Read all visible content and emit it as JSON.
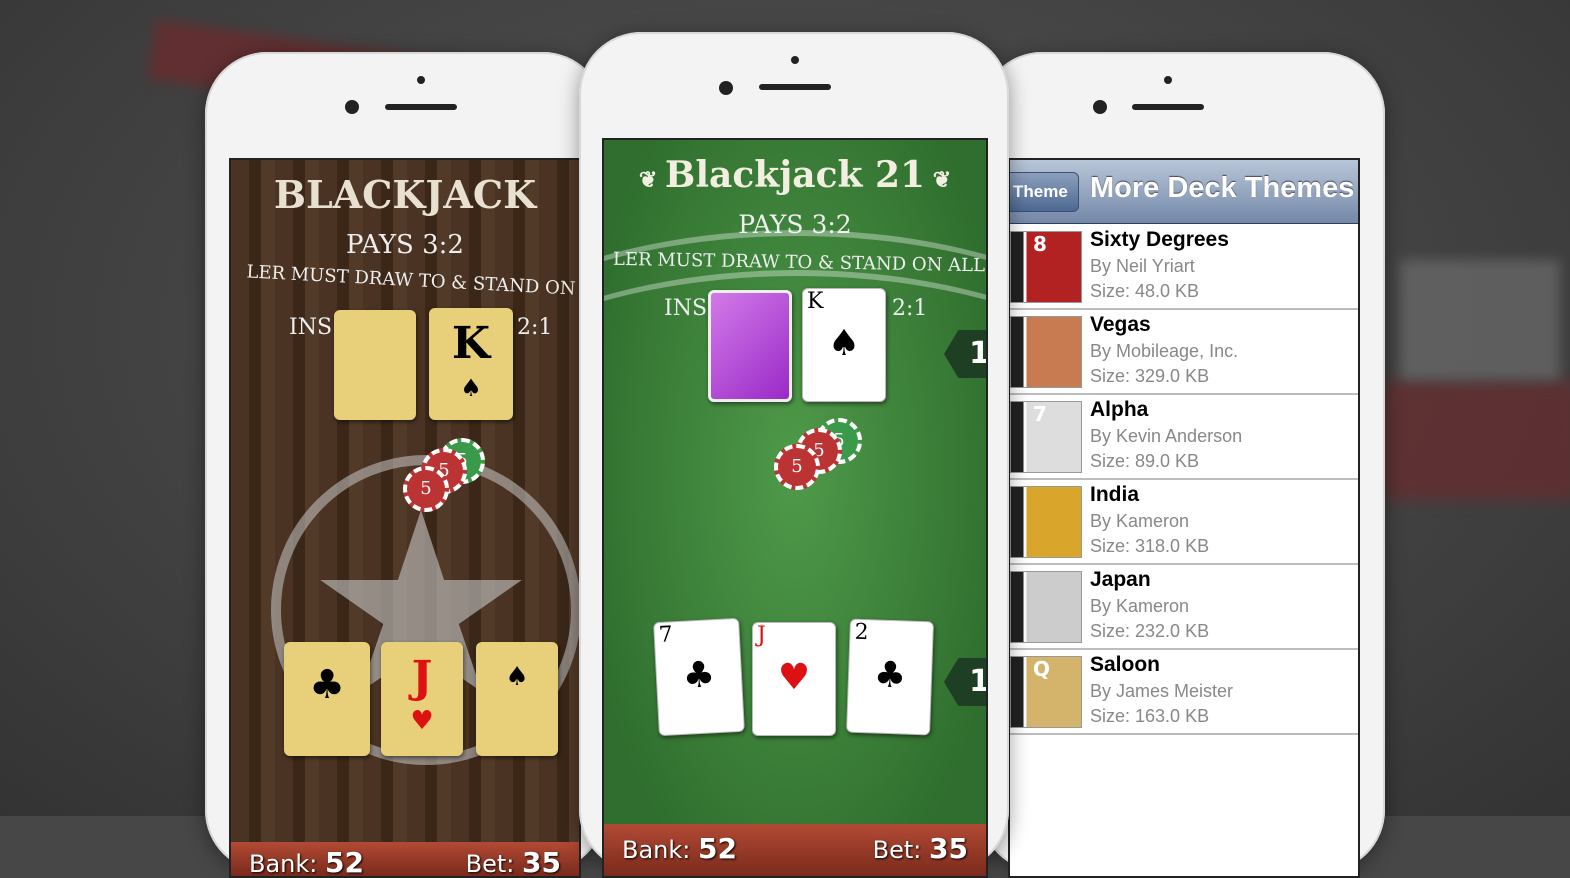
{
  "left_game": {
    "title": "BLACKJACK",
    "pays": "PAYS 3:2",
    "rule": "LER MUST DRAW TO & STAND ON",
    "insurance_left": "INS",
    "insurance_right": "2:1",
    "dealer_cards": [
      {
        "rank": "",
        "suit": ""
      },
      {
        "rank": "K",
        "suit": "♠"
      }
    ],
    "chips": [
      "5",
      "5",
      "5"
    ],
    "player_cards": [
      {
        "rank": "",
        "suit": "♣"
      },
      {
        "rank": "J",
        "suit": "♥"
      },
      {
        "rank": "",
        "suit": "♠"
      }
    ],
    "bank_label": "Bank:",
    "bank": "52",
    "bet_label": "Bet:",
    "bet": "35"
  },
  "center_game": {
    "title": "Blackjack 21",
    "pays": "PAYS 3:2",
    "rule": "LER MUST DRAW TO & STAND ON ALL",
    "insurance_left": "INS",
    "insurance_right": "2:1",
    "dealer_cards": [
      {
        "rank": "",
        "suit": "",
        "face_down": true
      },
      {
        "rank": "K",
        "suit": "♠"
      }
    ],
    "chips": [
      "5",
      "5",
      "5"
    ],
    "player_cards": [
      {
        "rank": "7",
        "suit": "♣"
      },
      {
        "rank": "J",
        "suit": "♥"
      },
      {
        "rank": "2",
        "suit": "♣"
      }
    ],
    "hand_markers": [
      "1",
      "1"
    ],
    "bank_label": "Bank:",
    "bank": "52",
    "bet_label": "Bet:",
    "bet": "35"
  },
  "themes_screen": {
    "back_button": "Theme",
    "title": "More Deck Themes",
    "items": [
      {
        "name": "Sixty Degrees",
        "author": "By Neil Yriart",
        "size": "Size: 48.0 KB",
        "thumb": "#b22222",
        "thumb_text": "8"
      },
      {
        "name": "Vegas",
        "author": "By Mobileage, Inc.",
        "size": "Size: 329.0 KB",
        "thumb": "#c87a50",
        "thumb_text": ""
      },
      {
        "name": "Alpha",
        "author": "By Kevin Anderson",
        "size": "Size: 89.0 KB",
        "thumb": "#dddddd",
        "thumb_text": "7"
      },
      {
        "name": "India",
        "author": "By Kameron",
        "size": "Size: 318.0 KB",
        "thumb": "#d9a52a",
        "thumb_text": ""
      },
      {
        "name": "Japan",
        "author": "By Kameron",
        "size": "Size: 232.0 KB",
        "thumb": "#cccccc",
        "thumb_text": ""
      },
      {
        "name": "Saloon",
        "author": "By James Meister",
        "size": "Size: 163.0 KB",
        "thumb": "#d4b46a",
        "thumb_text": "Q"
      }
    ]
  }
}
